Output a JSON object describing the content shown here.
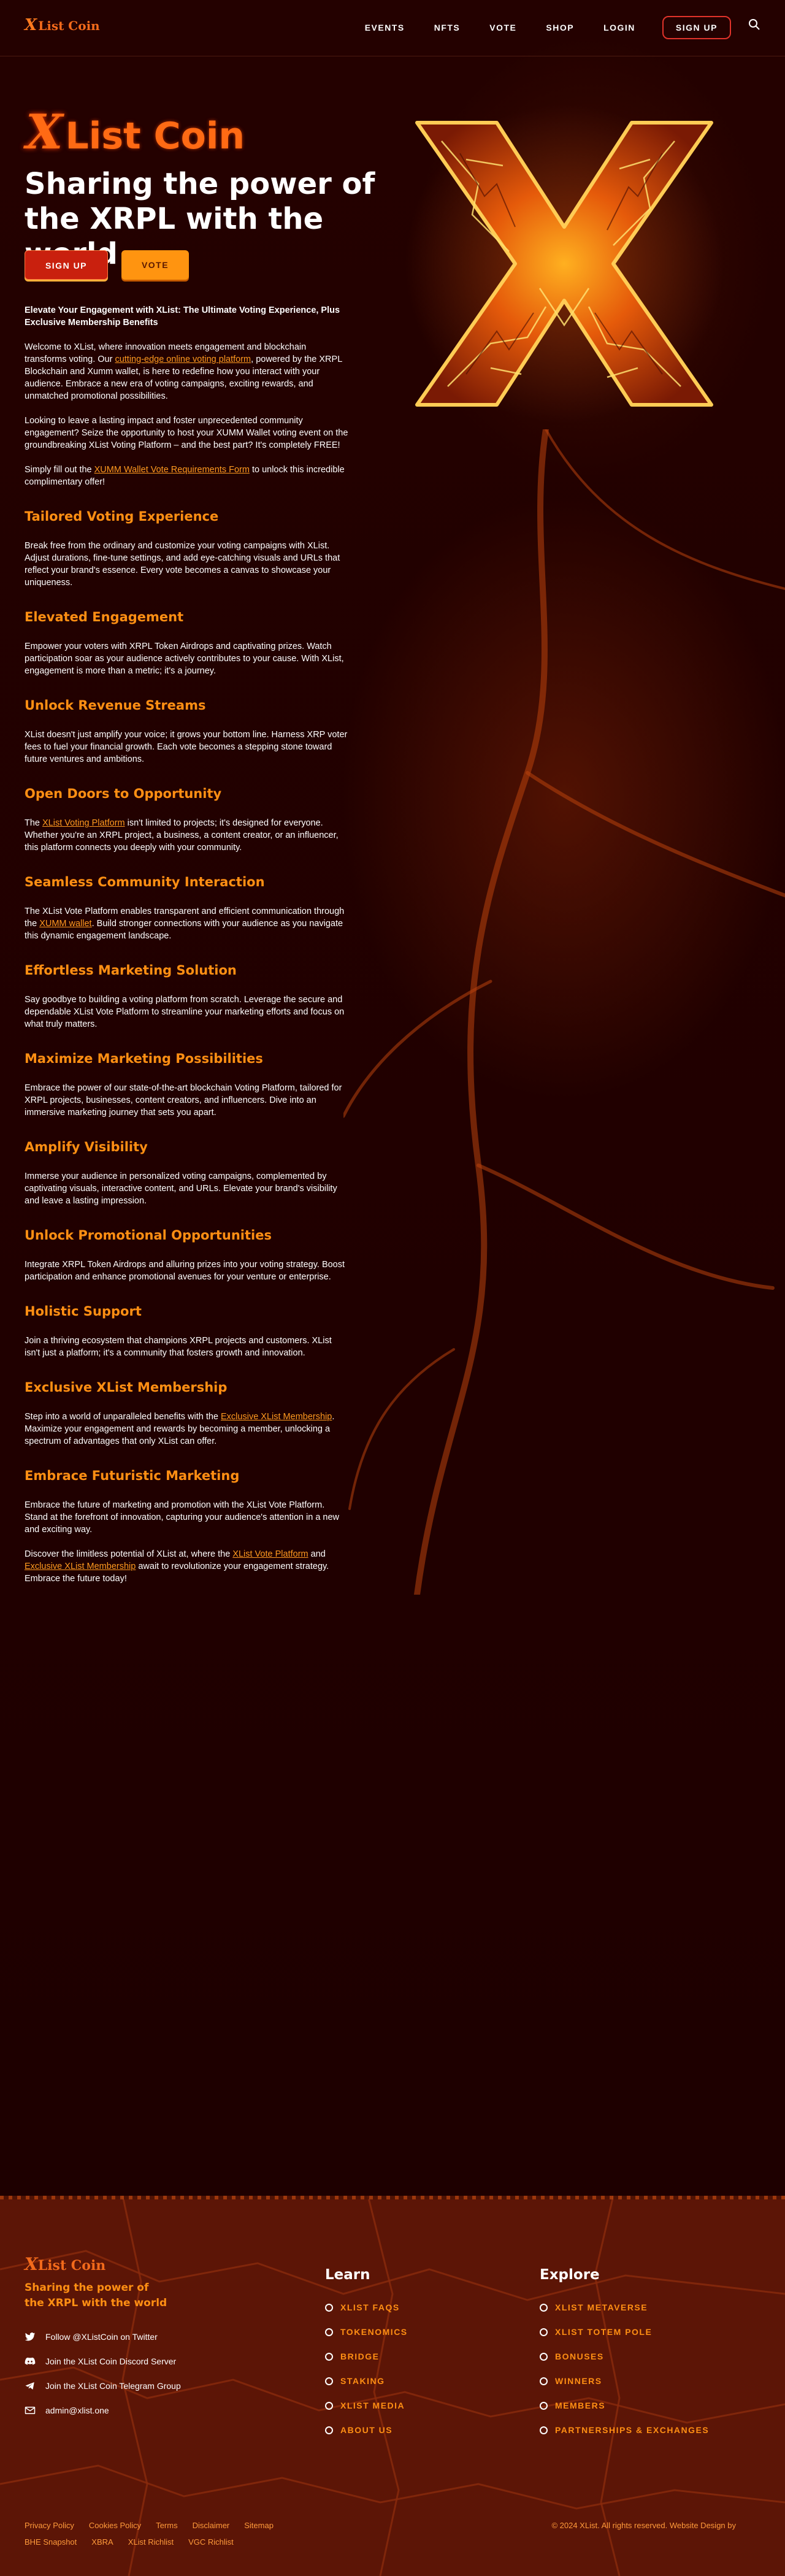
{
  "header": {
    "logo_x": "X",
    "logo_text": "List Coin",
    "nav": [
      "EVENTS",
      "NFTS",
      "VOTE",
      "SHOP",
      "LOGIN"
    ],
    "signup": "SIGN UP"
  },
  "hero": {
    "logo_x": "X",
    "logo_text": "List Coin",
    "title": "Sharing the power of the XRPL with the world",
    "btn_signup": "SIGN UP",
    "btn_vote": "VOTE"
  },
  "content": {
    "intro_heading": "Elevate Your Engagement with XList: The Ultimate Voting Experience, Plus Exclusive Membership Benefits",
    "p1_a": "Welcome to XList, where innovation meets engagement and blockchain transforms voting. Our ",
    "p1_link": "cutting-edge online voting platform",
    "p1_b": ", powered by the XRPL Blockchain and Xumm wallet, is here to redefine how you interact with your audience. Embrace a new era of voting campaigns, exciting rewards, and unmatched promotional possibilities.",
    "p2": "Looking to leave a lasting impact and foster unprecedented community engagement? Seize the opportunity to host your XUMM Wallet voting event on the groundbreaking XList Voting Platform – and the best part? It's completely FREE!",
    "p3_a": "Simply fill out the ",
    "p3_link": "XUMM Wallet Vote Requirements Form",
    "p3_b": " to unlock this incredible complimentary offer!",
    "s1_h": "Tailored Voting Experience",
    "s1_p": "Break free from the ordinary and customize your voting campaigns with XList. Adjust durations, fine-tune settings, and add eye-catching visuals and URLs that reflect your brand's essence. Every vote becomes a canvas to showcase your uniqueness.",
    "s2_h": "Elevated Engagement",
    "s2_p": "Empower your voters with XRPL Token Airdrops and captivating prizes. Watch participation soar as your audience actively contributes to your cause. With XList, engagement is more than a metric; it's a journey.",
    "s3_h": "Unlock Revenue Streams",
    "s3_p": "XList doesn't just amplify your voice; it grows your bottom line. Harness XRP voter fees to fuel your financial growth. Each vote becomes a stepping stone toward future ventures and ambitions.",
    "s4_h": "Open Doors to Opportunity",
    "s4_a": "The ",
    "s4_link": "XList Voting Platform",
    "s4_b": " isn't limited to projects; it's designed for everyone. Whether you're an XRPL project, a business, a content creator, or an influencer, this platform connects you deeply with your community.",
    "s5_h": "Seamless Community Interaction",
    "s5_a": "The XList Vote Platform enables transparent and efficient communication through the ",
    "s5_link": "XUMM wallet",
    "s5_b": ". Build stronger connections with your audience as you navigate this dynamic engagement landscape.",
    "s6_h": "Effortless Marketing Solution",
    "s6_p": "Say goodbye to building a voting platform from scratch. Leverage the secure and dependable XList Vote Platform to streamline your marketing efforts and focus on what truly matters.",
    "s7_h": "Maximize Marketing Possibilities",
    "s7_p": "Embrace the power of our state-of-the-art blockchain Voting Platform, tailored for XRPL projects, businesses, content creators, and influencers. Dive into an immersive marketing journey that sets you apart.",
    "s8_h": "Amplify Visibility",
    "s8_p": "Immerse your audience in personalized voting campaigns, complemented by captivating visuals, interactive content, and URLs. Elevate your brand's visibility and leave a lasting impression.",
    "s9_h": "Unlock Promotional Opportunities",
    "s9_p": "Integrate XRPL Token Airdrops and alluring prizes into your voting strategy. Boost participation and enhance promotional avenues for your venture or enterprise.",
    "s10_h": "Holistic Support",
    "s10_p": "Join a thriving ecosystem that champions XRPL projects and customers. XList isn't just a platform; it's a community that fosters growth and innovation.",
    "s11_h": "Exclusive XList Membership",
    "s11_a": "Step into a world of unparalleled benefits with the ",
    "s11_link": "Exclusive XList Membership",
    "s11_b": ". Maximize your engagement and rewards by becoming a member, unlocking a spectrum of advantages that only XList can offer.",
    "s12_h": "Embrace Futuristic Marketing",
    "s12_p": "Embrace the future of marketing and promotion with the XList Vote Platform. Stand at the forefront of innovation, capturing your audience's attention in a new and exciting way.",
    "s12_a": "Discover the limitless potential of XList at, where the ",
    "s12_link1": "XList Vote Platform",
    "s12_mid": " and ",
    "s12_link2": "Exclusive XList Membership",
    "s12_b": " await to revolutionize your engagement strategy. Embrace the future today!"
  },
  "footer": {
    "logo_x": "X",
    "logo_text": "List Coin",
    "tagline": "Sharing the power of the XRPL with the world",
    "social": [
      "Follow @XListCoin on Twitter",
      "Join the XList Coin Discord Server",
      "Join the XList Coin Telegram Group",
      "admin@xlist.one"
    ],
    "learn_title": "Learn",
    "learn": [
      "XLIST FAQS",
      "TOKENOMICS",
      "BRIDGE",
      "STAKING",
      "XLIST MEDIA",
      "ABOUT US"
    ],
    "explore_title": "Explore",
    "explore": [
      "XLIST METAVERSE",
      "XLIST TOTEM POLE",
      "BONUSES",
      "WINNERS",
      "MEMBERS",
      "PARTNERSHIPS & EXCHANGES"
    ],
    "links1": [
      "Privacy Policy",
      "Cookies Policy",
      "Terms",
      "Disclaimer",
      "Sitemap"
    ],
    "links2": [
      "BHE Snapshot",
      "XBRA",
      "XList Richlist",
      "VGC Richlist"
    ],
    "copyright": "© 2024 XList. All rights reserved. Website Design by"
  },
  "colors": {
    "accent": "#ff8f13",
    "brand": "#f26a1b",
    "bg": "#1e0000",
    "footer_bg": "#5c1506"
  }
}
